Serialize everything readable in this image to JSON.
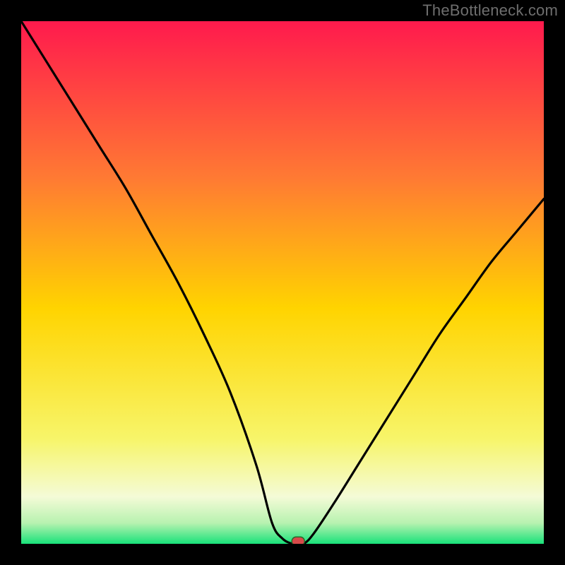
{
  "watermark": "TheBottleneck.com",
  "palette": {
    "frame": "#000000",
    "grad_top": "#ff1a4d",
    "grad_upper_mid": "#ff7a33",
    "grad_mid": "#ffd400",
    "grad_lower_mid": "#f7f56a",
    "grad_pale": "#f4fbd7",
    "grad_green": "#19e27a",
    "curve": "#000000",
    "marker_fill": "#d74a4a",
    "marker_stroke": "#2a6a2a"
  },
  "chart_data": {
    "type": "line",
    "title": "",
    "xlabel": "",
    "ylabel": "",
    "xlim": [
      0,
      100
    ],
    "ylim": [
      0,
      100
    ],
    "series": [
      {
        "name": "bottleneck-curve",
        "x": [
          0,
          5,
          10,
          15,
          20,
          25,
          30,
          35,
          40,
          45,
          48,
          50,
          52,
          54,
          56,
          60,
          65,
          70,
          75,
          80,
          85,
          90,
          95,
          100
        ],
        "y": [
          100,
          92,
          84,
          76,
          68,
          59,
          50,
          40,
          29,
          15,
          4,
          1,
          0,
          0,
          2,
          8,
          16,
          24,
          32,
          40,
          47,
          54,
          60,
          66
        ]
      }
    ],
    "marker": {
      "x": 53,
      "y": 0.5
    },
    "gradient_stops": [
      {
        "offset": 0.0,
        "color": "#ff1a4d"
      },
      {
        "offset": 0.3,
        "color": "#ff7a33"
      },
      {
        "offset": 0.55,
        "color": "#ffd400"
      },
      {
        "offset": 0.8,
        "color": "#f7f56a"
      },
      {
        "offset": 0.91,
        "color": "#f4fbd7"
      },
      {
        "offset": 0.96,
        "color": "#b8f2b0"
      },
      {
        "offset": 1.0,
        "color": "#19e27a"
      }
    ]
  }
}
